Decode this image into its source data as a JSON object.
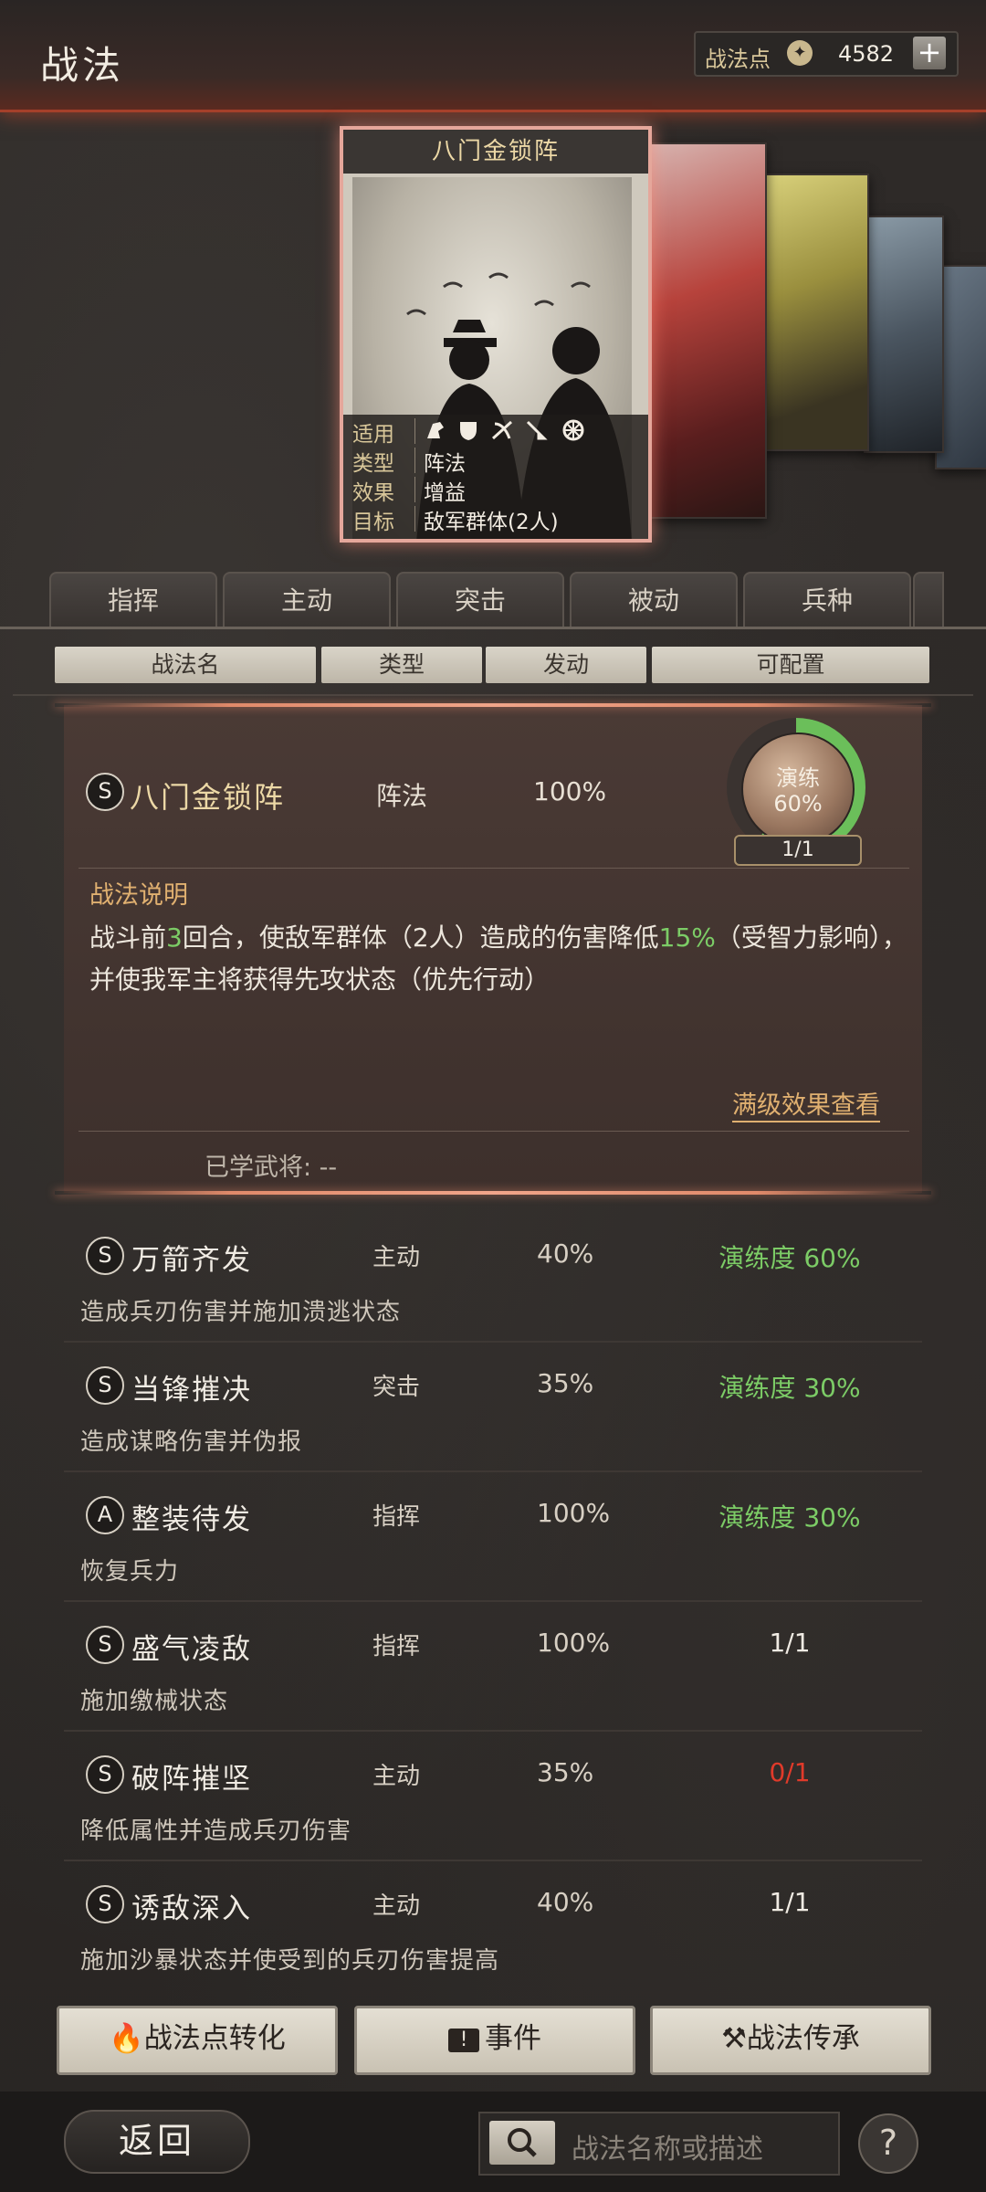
{
  "header": {
    "title": "战法",
    "points_label": "战法点",
    "points_value": "4582",
    "add_label": "+"
  },
  "featured_card": {
    "title": "八门金锁阵",
    "rows": [
      {
        "key": "适用",
        "value": ""
      },
      {
        "key": "类型",
        "value": "阵法"
      },
      {
        "key": "效果",
        "value": "增益"
      },
      {
        "key": "目标",
        "value": "敌军群体(2人)"
      }
    ]
  },
  "tabs": [
    "指挥",
    "主动",
    "突击",
    "被动",
    "兵种"
  ],
  "columns": [
    "战法名",
    "类型",
    "发动",
    "可配置"
  ],
  "selected": {
    "grade": "S",
    "name": "八门金锁阵",
    "type": "阵法",
    "rate": "100%",
    "ring_label": "演练",
    "ring_percent": "60%",
    "ring_value": 0.6,
    "ring_count": "1/1",
    "desc_title": "战法说明",
    "desc_part1": "战斗前",
    "desc_num1": "3",
    "desc_part2": "回合，使敌军群体（2人）造成的伤害降低",
    "desc_num2": "15%",
    "desc_part3": "（受智力影响），并使我军主将获得先攻状态（优先行动）",
    "full_link": "满级效果查看",
    "learned": "已学武将:  --"
  },
  "items": [
    {
      "grade": "S",
      "name": "万箭齐发",
      "type": "主动",
      "rate": "40%",
      "prog": "演练度 60%",
      "prog_color": "#7ccc66",
      "desc": "造成兵刃伤害并施加溃逃状态"
    },
    {
      "grade": "S",
      "name": "当锋摧决",
      "type": "突击",
      "rate": "35%",
      "prog": "演练度 30%",
      "prog_color": "#7ccc66",
      "desc": "造成谋略伤害并伪报"
    },
    {
      "grade": "A",
      "name": "整装待发",
      "type": "指挥",
      "rate": "100%",
      "prog": "演练度 30%",
      "prog_color": "#7ccc66",
      "desc": "恢复兵力"
    },
    {
      "grade": "S",
      "name": "盛气凌敌",
      "type": "指挥",
      "rate": "100%",
      "prog": "1/1",
      "prog_color": "#f0ebe3",
      "desc": "施加缴械状态"
    },
    {
      "grade": "S",
      "name": "破阵摧坚",
      "type": "主动",
      "rate": "35%",
      "prog": "0/1",
      "prog_color": "#e03a2a",
      "desc": "降低属性并造成兵刃伤害"
    },
    {
      "grade": "S",
      "name": "诱敌深入",
      "type": "主动",
      "rate": "40%",
      "prog": "1/1",
      "prog_color": "#f0ebe3",
      "desc": "施加沙暴状态并使受到的兵刃伤害提高"
    }
  ],
  "buttons": {
    "convert": "战法点转化",
    "event": "事件",
    "inherit": "战法传承"
  },
  "footer": {
    "back": "返回",
    "search_placeholder": "战法名称或描述",
    "help": "?"
  },
  "colors": {
    "accent": "#e0b070",
    "green": "#7ccc66",
    "red": "#e03a2a"
  }
}
